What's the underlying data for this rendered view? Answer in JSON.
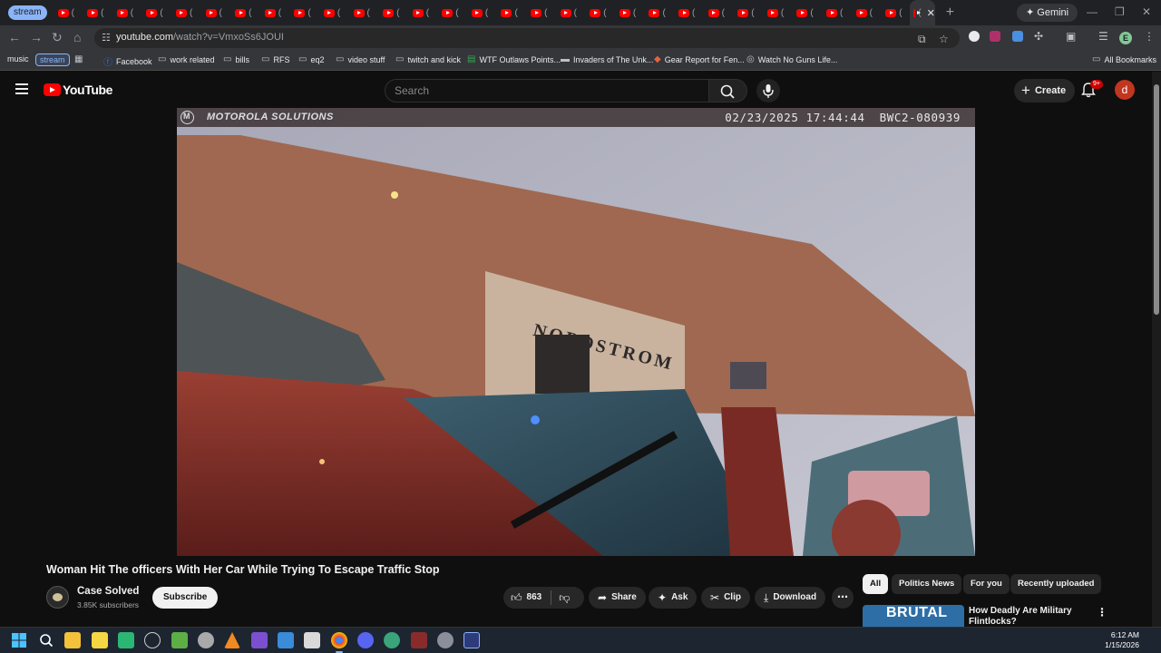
{
  "browser": {
    "first_tab_label": "stream",
    "tab_count": 30,
    "tab_paren": "(",
    "gemini_label": "Gemini",
    "url_host": "youtube.com",
    "url_path": "/watch?v=VmxoSs6JOUI",
    "profile_initial": "E",
    "win_min": "—",
    "win_max": "❐",
    "win_close": "✕",
    "tab_close": "✕",
    "new_tab": "+"
  },
  "bookmarks": {
    "items": [
      {
        "label": "music",
        "icon": "none"
      },
      {
        "label": "stream",
        "icon": "none",
        "style": "pill"
      },
      {
        "label": "",
        "icon": "apps-grid-icon"
      },
      {
        "label": "Facebook",
        "icon": "facebook-icon"
      },
      {
        "label": "work related",
        "icon": "folder-icon"
      },
      {
        "label": "bills",
        "icon": "folder-icon"
      },
      {
        "label": "RFS",
        "icon": "folder-icon"
      },
      {
        "label": "eq2",
        "icon": "folder-icon"
      },
      {
        "label": "video stuff",
        "icon": "folder-icon"
      },
      {
        "label": "twitch and kick",
        "icon": "folder-icon"
      },
      {
        "label": "WTF Outlaws Points...",
        "icon": "sheets-icon"
      },
      {
        "label": "Invaders of The Unk...",
        "icon": "page-icon"
      },
      {
        "label": "Gear Report for Fen...",
        "icon": "page-icon"
      },
      {
        "label": "Watch No Guns Life...",
        "icon": "page-icon"
      }
    ],
    "all_bookmarks": "All Bookmarks"
  },
  "youtube": {
    "logo_text": "YouTube",
    "search_placeholder": "Search",
    "create_label": "Create",
    "notification_badge": "9+",
    "avatar_initial": "d"
  },
  "video": {
    "overlay_brand": "MOTOROLA SOLUTIONS",
    "overlay_datetime": "02/23/2025 17:44:44",
    "overlay_camera_id": "BWC2-080939",
    "store_sign": "NORDSTROM",
    "title": "Woman Hit The officers With Her Car While Trying To Escape Traffic Stop",
    "channel_name": "Case Solved",
    "subscribers": "3.85K subscribers",
    "subscribe_label": "Subscribe",
    "like_count": "863",
    "share_label": "Share",
    "ask_label": "Ask",
    "clip_label": "Clip",
    "download_label": "Download"
  },
  "sidebar": {
    "chips": [
      "All",
      "Politics News",
      "For you",
      "Recently uploaded"
    ],
    "rec_thumb_text": "BRUTAL",
    "rec_title": "How Deadly Are Military Flintlocks?"
  },
  "taskbar": {
    "time": "6:12 AM",
    "date": "1/15/2026"
  },
  "colors": {
    "youtube_red": "#ff0000",
    "browser_dark": "#202124",
    "yt_background": "#0f0f0f",
    "accent_blue": "#8ab4f8"
  }
}
